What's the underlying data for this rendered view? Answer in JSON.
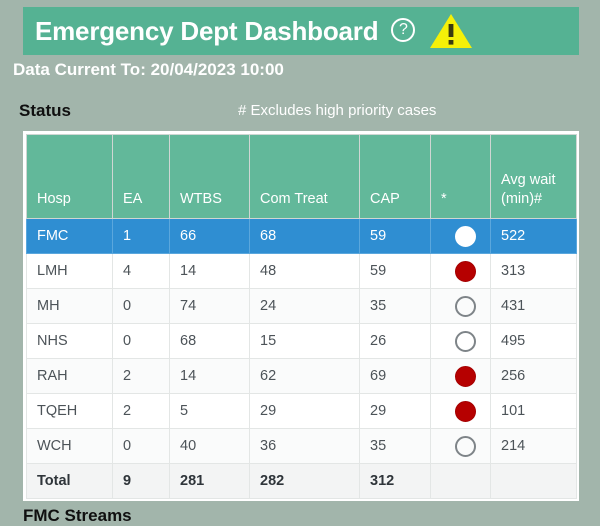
{
  "header": {
    "title": "Emergency Dept Dashboard",
    "help_icon_label": "?",
    "warning_icon_name": "warning-triangle-icon",
    "bg_color": "#55b293",
    "warning_color": "#f5f008"
  },
  "data_current": {
    "text": "Data Current To: 20/04/2023 10:00"
  },
  "section": {
    "status_label": "Status",
    "note": "# Excludes high priority cases"
  },
  "table": {
    "columns": [
      {
        "key": "hosp",
        "label": "Hosp",
        "label_line2": ""
      },
      {
        "key": "ea",
        "label": "EA",
        "label_line2": ""
      },
      {
        "key": "wtbs",
        "label": "WTBS",
        "label_line2": ""
      },
      {
        "key": "com_treat",
        "label": "Com Treat",
        "label_line2": ""
      },
      {
        "key": "cap",
        "label": "CAP",
        "label_line2": ""
      },
      {
        "key": "star",
        "label": "*",
        "label_line2": ""
      },
      {
        "key": "avg_wait",
        "label": "Avg wait",
        "label_line2": "(min)#"
      }
    ],
    "rows": [
      {
        "hosp": "FMC",
        "ea": "1",
        "wtbs": "66",
        "com_treat": "68",
        "cap": "59",
        "status": "filled-white",
        "avg_wait": "522",
        "selected": true
      },
      {
        "hosp": "LMH",
        "ea": "4",
        "wtbs": "14",
        "com_treat": "48",
        "cap": "59",
        "status": "filled-red",
        "avg_wait": "313",
        "selected": false
      },
      {
        "hosp": "MH",
        "ea": "0",
        "wtbs": "74",
        "com_treat": "24",
        "cap": "35",
        "status": "hollow",
        "avg_wait": "431",
        "selected": false
      },
      {
        "hosp": "NHS",
        "ea": "0",
        "wtbs": "68",
        "com_treat": "15",
        "cap": "26",
        "status": "hollow",
        "avg_wait": "495",
        "selected": false
      },
      {
        "hosp": "RAH",
        "ea": "2",
        "wtbs": "14",
        "com_treat": "62",
        "cap": "69",
        "status": "filled-red",
        "avg_wait": "256",
        "selected": false
      },
      {
        "hosp": "TQEH",
        "ea": "2",
        "wtbs": "5",
        "com_treat": "29",
        "cap": "29",
        "status": "filled-red",
        "avg_wait": "101",
        "selected": false
      },
      {
        "hosp": "WCH",
        "ea": "0",
        "wtbs": "40",
        "com_treat": "36",
        "cap": "35",
        "status": "hollow",
        "avg_wait": "214",
        "selected": false
      }
    ],
    "total_row": {
      "hosp": "Total",
      "ea": "9",
      "wtbs": "281",
      "com_treat": "282",
      "cap": "312",
      "status": "",
      "avg_wait": ""
    },
    "header_bg": "#62b89a",
    "selected_bg": "#2f8ed2",
    "red_dot_color": "#b60000"
  },
  "bottom_section": {
    "heading": "FMC Streams"
  }
}
